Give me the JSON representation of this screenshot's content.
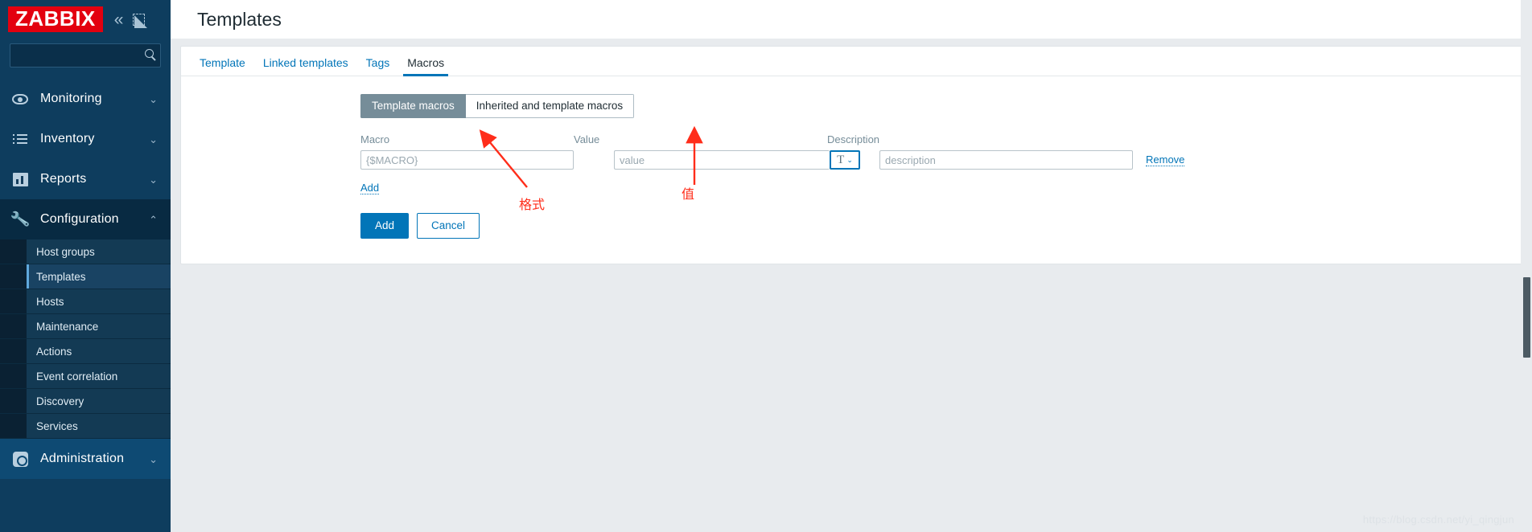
{
  "sidebar": {
    "logo_text": "ZABBIX",
    "collapse_icon": "chevron-double-left",
    "expand_icon": "expand-square",
    "search": {
      "value": "",
      "placeholder": ""
    },
    "nav": [
      {
        "label": "Monitoring",
        "icon": "eye-icon",
        "chevron": "⌄",
        "state": "collapsed"
      },
      {
        "label": "Inventory",
        "icon": "list-icon",
        "chevron": "⌄",
        "state": "collapsed"
      },
      {
        "label": "Reports",
        "icon": "chart-icon",
        "chevron": "⌄",
        "state": "collapsed"
      },
      {
        "label": "Configuration",
        "icon": "wrench-icon",
        "chevron": "⌃",
        "state": "expanded"
      }
    ],
    "submenu": [
      {
        "label": "Host groups",
        "selected": false
      },
      {
        "label": "Templates",
        "selected": true
      },
      {
        "label": "Hosts",
        "selected": false
      },
      {
        "label": "Maintenance",
        "selected": false
      },
      {
        "label": "Actions",
        "selected": false
      },
      {
        "label": "Event correlation",
        "selected": false
      },
      {
        "label": "Discovery",
        "selected": false
      },
      {
        "label": "Services",
        "selected": false
      }
    ],
    "admin": {
      "label": "Administration",
      "icon": "gear-icon",
      "chevron": "⌄"
    }
  },
  "header": {
    "title": "Templates"
  },
  "tabs": [
    {
      "label": "Template",
      "active": false
    },
    {
      "label": "Linked templates",
      "active": false
    },
    {
      "label": "Tags",
      "active": false
    },
    {
      "label": "Macros",
      "active": true
    }
  ],
  "macros": {
    "segments": [
      {
        "label": "Template macros",
        "active": true
      },
      {
        "label": "Inherited and template macros",
        "active": false
      }
    ],
    "columns": {
      "macro": "Macro",
      "value": "Value",
      "description": "Description"
    },
    "row": {
      "macro_value": "",
      "macro_placeholder": "{$MACRO}",
      "value_value": "",
      "value_placeholder": "value",
      "type_glyph": "T",
      "type_chevron": "⌄",
      "description_value": "",
      "description_placeholder": "description",
      "remove_label": "Remove"
    },
    "add_link": "Add"
  },
  "buttons": {
    "add": "Add",
    "cancel": "Cancel"
  },
  "annotations": [
    {
      "text": "格式",
      "note": "format - points to Macro field"
    },
    {
      "text": "值",
      "note": "value - points to Value field"
    }
  ],
  "watermark": "https://blog.csdn.net/yi_qingjun",
  "colors": {
    "brand_red": "#e3000f",
    "sidebar_bg": "#0e3d5e",
    "accent_blue": "#0275b8",
    "segment_active": "#768d99",
    "annotation_red": "#ff2d1a"
  }
}
